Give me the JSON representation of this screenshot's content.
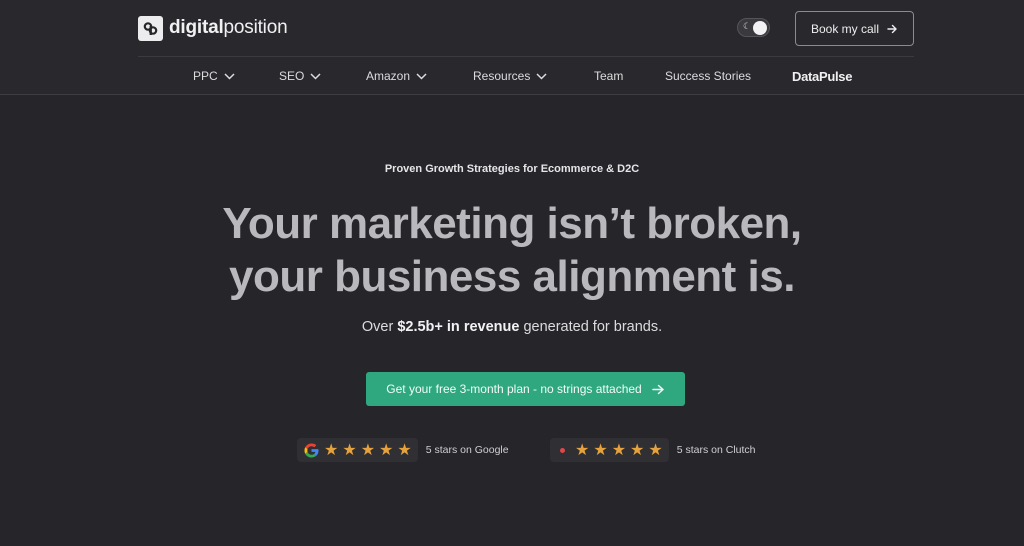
{
  "header": {
    "logo": {
      "bold": "digital",
      "regular": "position",
      "icon": "dp-logo-icon"
    },
    "theme_toggle": {
      "icon": "moon-icon",
      "state": "on"
    },
    "book_button": {
      "label": "Book my call",
      "icon": "arrow-right-icon"
    }
  },
  "nav": {
    "items": [
      {
        "label": "PPC",
        "dropdown": true
      },
      {
        "label": "SEO",
        "dropdown": true
      },
      {
        "label": "Amazon",
        "dropdown": true
      },
      {
        "label": "Resources",
        "dropdown": true
      },
      {
        "label": "Team",
        "dropdown": false
      },
      {
        "label": "Success Stories",
        "dropdown": false
      },
      {
        "label": "DataPulse",
        "dropdown": false
      }
    ]
  },
  "hero": {
    "eyebrow": "Proven Growth Strategies for Ecommerce & D2C",
    "headline_line1": "Your marketing isn’t broken,",
    "headline_line2": "your business alignment is.",
    "sub_prefix": "Over ",
    "sub_bold": "$2.5b+ in revenue",
    "sub_suffix": " generated for brands.",
    "cta_label": "Get your free 3-month plan - no strings attached",
    "cta_icon": "arrow-right-icon"
  },
  "ratings": [
    {
      "source_icon": "google-icon",
      "stars": 5,
      "text": "5 stars on Google"
    },
    {
      "source_icon": "clutch-icon",
      "stars": 5,
      "text": "5 stars on Clutch"
    }
  ],
  "colors": {
    "background": "#262529",
    "cta": "#2fa87f",
    "star": "#e6a23c",
    "headline": "#b9b9bd"
  }
}
